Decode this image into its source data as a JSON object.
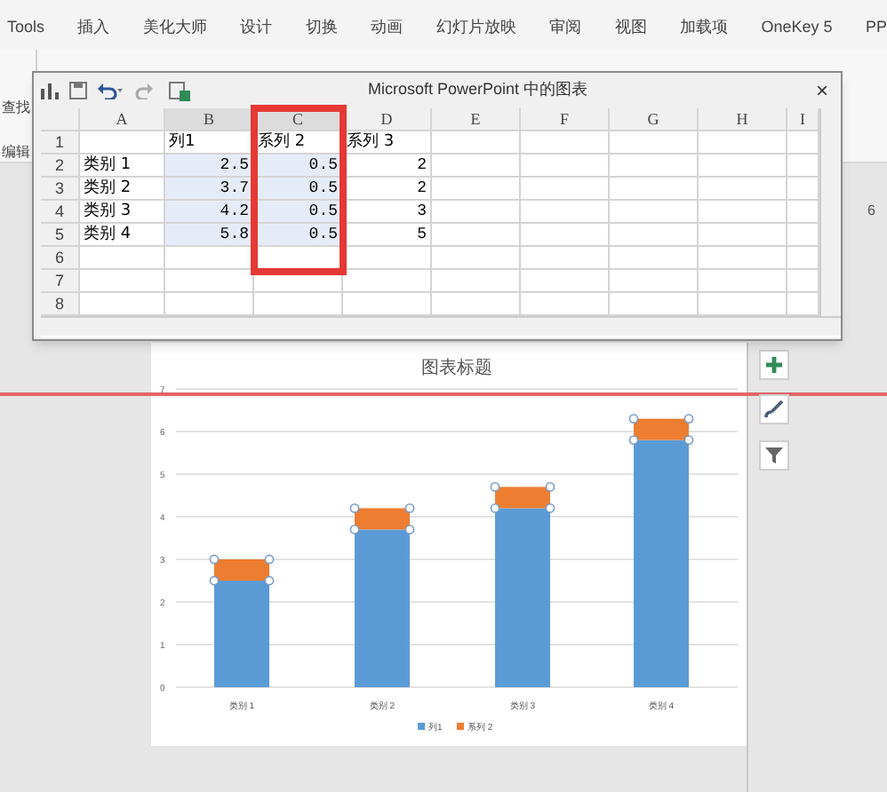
{
  "ribbon_tabs": [
    "Tools",
    "插入",
    "美化大师",
    "设计",
    "切换",
    "动画",
    "幻灯片放映",
    "审阅",
    "视图",
    "加载项",
    "OneKey 5",
    "PP"
  ],
  "ribbon_labels": [
    "查找",
    "编辑"
  ],
  "side_mark": "6",
  "chart_window": {
    "title": "Microsoft PowerPoint 中的图表",
    "close": "×",
    "columns": [
      "A",
      "B",
      "C",
      "D",
      "E",
      "F",
      "G",
      "H",
      "I"
    ],
    "rows": [
      {
        "number": "1",
        "selected": false,
        "cells": [
          null,
          "列1",
          "系列 2",
          "系列 3"
        ]
      },
      {
        "number": "2",
        "selected": true,
        "cells": [
          "类别 1",
          "2.5",
          "0.5",
          "2"
        ]
      },
      {
        "number": "3",
        "selected": true,
        "cells": [
          "类别 2",
          "3.7",
          "0.5",
          "2"
        ]
      },
      {
        "number": "4",
        "selected": true,
        "cells": [
          "类别 3",
          "4.2",
          "0.5",
          "3"
        ]
      },
      {
        "number": "5",
        "selected": true,
        "cells": [
          "类别 4",
          "5.8",
          "0.5",
          "5"
        ]
      },
      {
        "number": "6",
        "selected": false
      },
      {
        "number": "7",
        "selected": false
      },
      {
        "number": "8",
        "selected": false
      }
    ]
  },
  "chart": {
    "chart_data": {
      "type": "bar",
      "stacked": true,
      "title": "图表标题",
      "categories": [
        "类别 1",
        "类别 2",
        "类别 3",
        "类别 4"
      ],
      "series": [
        {
          "name": "列1",
          "color": "#5b9bd5",
          "values": [
            2.5,
            3.7,
            4.2,
            5.8
          ]
        },
        {
          "name": "系列 2",
          "color": "#ed7d31",
          "values": [
            0.5,
            0.5,
            0.5,
            0.5
          ]
        }
      ],
      "ylim": [
        0,
        7
      ],
      "yticks": [
        0,
        1,
        2,
        3,
        4,
        5,
        6,
        7
      ],
      "grid": true,
      "legend": true
    }
  }
}
